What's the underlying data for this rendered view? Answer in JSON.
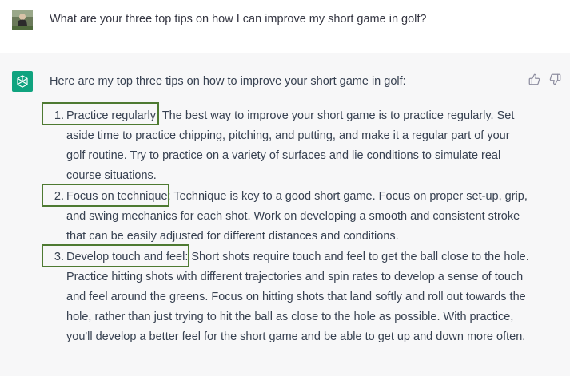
{
  "user_message": {
    "avatar": "user-photo",
    "text": "What are your three top tips on how I can improve my short game in golf?"
  },
  "assistant_message": {
    "avatar": "openai-logo-icon",
    "intro": "Here are my top three tips on how to improve your short game in golf:",
    "tips": [
      {
        "number": "1.",
        "title": "Practice regularly:",
        "body": " The best way to improve your short game is to practice regularly. Set aside time to practice chipping, pitching, and putting, and make it a regular part of your golf routine. Try to practice on a variety of surfaces and lie conditions to simulate real course situations."
      },
      {
        "number": "2.",
        "title": "Focus on technique:",
        "body": " Technique is key to a good short game. Focus on proper set-up, grip, and swing mechanics for each shot. Work on developing a smooth and consistent stroke that can be easily adjusted for different distances and conditions."
      },
      {
        "number": "3.",
        "title": "Develop touch and feel:",
        "body": " Short shots require touch and feel to get the ball close to the hole. Practice hitting shots with different trajectories and spin rates to develop a sense of touch and feel around the greens. Focus on hitting shots that land softly and roll out towards the hole, rather than just trying to hit the ball as close to the hole as possible. With practice, you'll develop a better feel for the short game and be able to get up and down more often."
      }
    ],
    "feedback": {
      "thumbs_up": "thumbs-up-icon",
      "thumbs_down": "thumbs-down-icon"
    }
  },
  "colors": {
    "highlight_box": "#4e7a32",
    "bot_avatar_bg": "#10a37f",
    "assistant_bg": "#f7f7f8"
  }
}
